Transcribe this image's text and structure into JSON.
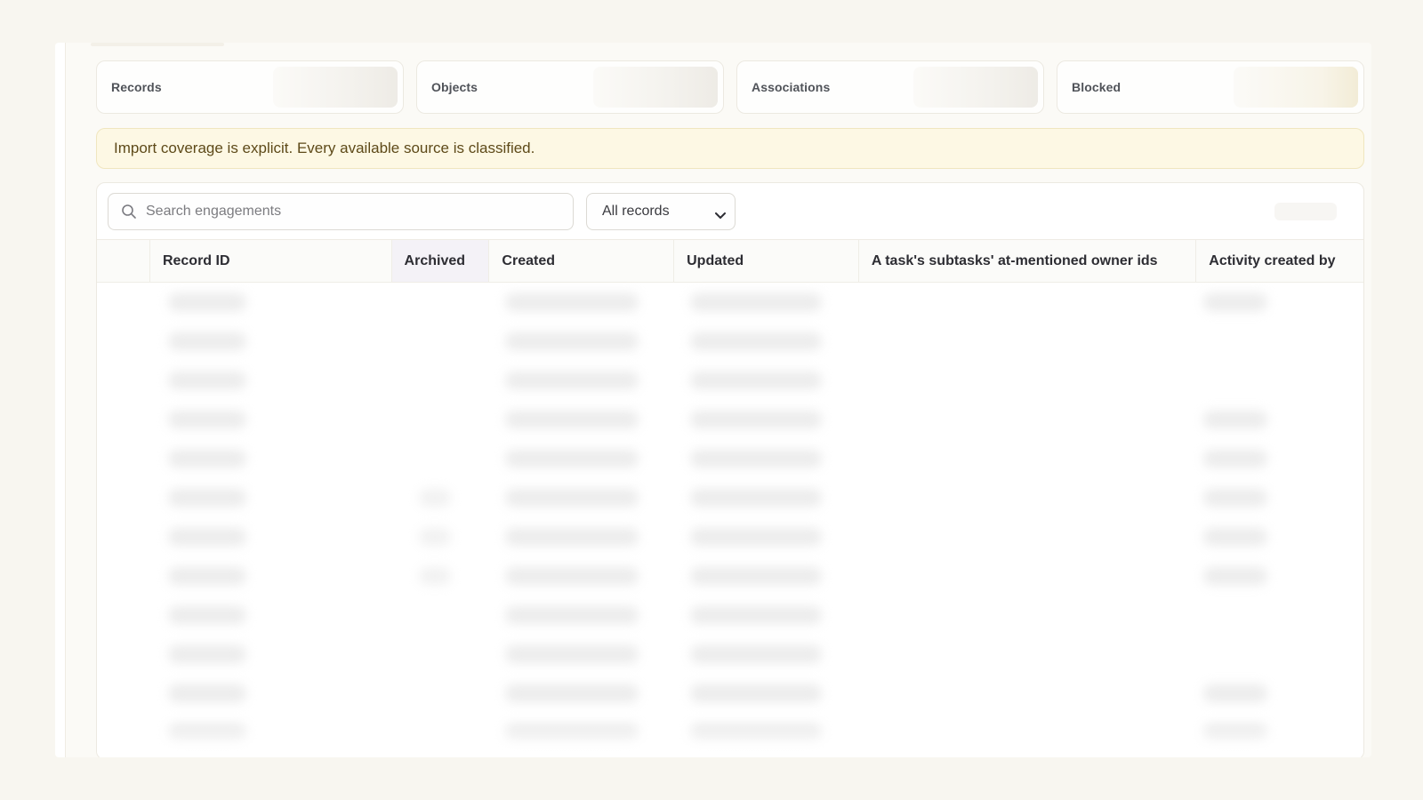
{
  "stats": {
    "records_label": "Records",
    "objects_label": "Objects",
    "associations_label": "Associations",
    "blocked_label": "Blocked"
  },
  "banner": {
    "text": "Import coverage is explicit. Every available source is classified."
  },
  "toolbar": {
    "search_placeholder": "Search engagements",
    "filter_selected": "All records"
  },
  "table": {
    "columns": {
      "record_id": "Record ID",
      "archived": "Archived",
      "created": "Created",
      "updated": "Updated",
      "task_owner_ids": "A task's subtasks' at-mentioned owner ids",
      "activity_created_by": "Activity created by"
    }
  },
  "colors": {
    "background": "#f8f6f0",
    "banner_bg": "#fdf8e4",
    "banner_text": "#5e4a19",
    "archived_header_bg": "#f4f2f7"
  }
}
